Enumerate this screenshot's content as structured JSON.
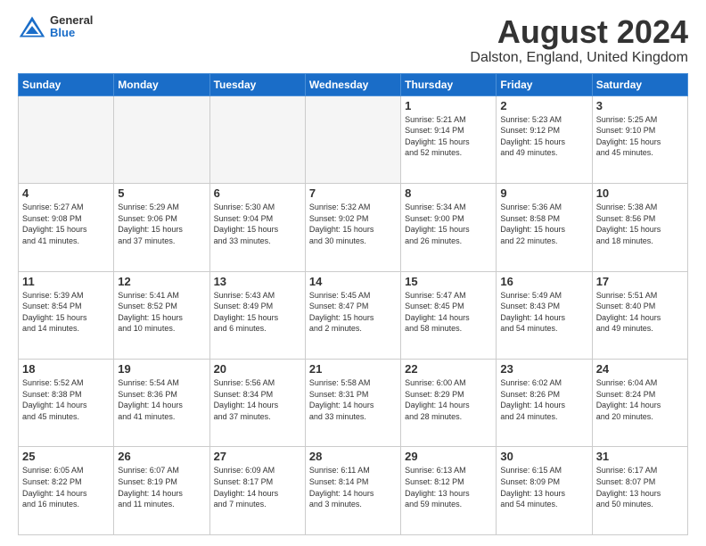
{
  "logo": {
    "general": "General",
    "blue": "Blue"
  },
  "title": "August 2024",
  "subtitle": "Dalston, England, United Kingdom",
  "days_of_week": [
    "Sunday",
    "Monday",
    "Tuesday",
    "Wednesday",
    "Thursday",
    "Friday",
    "Saturday"
  ],
  "weeks": [
    [
      {
        "day": "",
        "info": ""
      },
      {
        "day": "",
        "info": ""
      },
      {
        "day": "",
        "info": ""
      },
      {
        "day": "",
        "info": ""
      },
      {
        "day": "1",
        "info": "Sunrise: 5:21 AM\nSunset: 9:14 PM\nDaylight: 15 hours\nand 52 minutes."
      },
      {
        "day": "2",
        "info": "Sunrise: 5:23 AM\nSunset: 9:12 PM\nDaylight: 15 hours\nand 49 minutes."
      },
      {
        "day": "3",
        "info": "Sunrise: 5:25 AM\nSunset: 9:10 PM\nDaylight: 15 hours\nand 45 minutes."
      }
    ],
    [
      {
        "day": "4",
        "info": "Sunrise: 5:27 AM\nSunset: 9:08 PM\nDaylight: 15 hours\nand 41 minutes."
      },
      {
        "day": "5",
        "info": "Sunrise: 5:29 AM\nSunset: 9:06 PM\nDaylight: 15 hours\nand 37 minutes."
      },
      {
        "day": "6",
        "info": "Sunrise: 5:30 AM\nSunset: 9:04 PM\nDaylight: 15 hours\nand 33 minutes."
      },
      {
        "day": "7",
        "info": "Sunrise: 5:32 AM\nSunset: 9:02 PM\nDaylight: 15 hours\nand 30 minutes."
      },
      {
        "day": "8",
        "info": "Sunrise: 5:34 AM\nSunset: 9:00 PM\nDaylight: 15 hours\nand 26 minutes."
      },
      {
        "day": "9",
        "info": "Sunrise: 5:36 AM\nSunset: 8:58 PM\nDaylight: 15 hours\nand 22 minutes."
      },
      {
        "day": "10",
        "info": "Sunrise: 5:38 AM\nSunset: 8:56 PM\nDaylight: 15 hours\nand 18 minutes."
      }
    ],
    [
      {
        "day": "11",
        "info": "Sunrise: 5:39 AM\nSunset: 8:54 PM\nDaylight: 15 hours\nand 14 minutes."
      },
      {
        "day": "12",
        "info": "Sunrise: 5:41 AM\nSunset: 8:52 PM\nDaylight: 15 hours\nand 10 minutes."
      },
      {
        "day": "13",
        "info": "Sunrise: 5:43 AM\nSunset: 8:49 PM\nDaylight: 15 hours\nand 6 minutes."
      },
      {
        "day": "14",
        "info": "Sunrise: 5:45 AM\nSunset: 8:47 PM\nDaylight: 15 hours\nand 2 minutes."
      },
      {
        "day": "15",
        "info": "Sunrise: 5:47 AM\nSunset: 8:45 PM\nDaylight: 14 hours\nand 58 minutes."
      },
      {
        "day": "16",
        "info": "Sunrise: 5:49 AM\nSunset: 8:43 PM\nDaylight: 14 hours\nand 54 minutes."
      },
      {
        "day": "17",
        "info": "Sunrise: 5:51 AM\nSunset: 8:40 PM\nDaylight: 14 hours\nand 49 minutes."
      }
    ],
    [
      {
        "day": "18",
        "info": "Sunrise: 5:52 AM\nSunset: 8:38 PM\nDaylight: 14 hours\nand 45 minutes."
      },
      {
        "day": "19",
        "info": "Sunrise: 5:54 AM\nSunset: 8:36 PM\nDaylight: 14 hours\nand 41 minutes."
      },
      {
        "day": "20",
        "info": "Sunrise: 5:56 AM\nSunset: 8:34 PM\nDaylight: 14 hours\nand 37 minutes."
      },
      {
        "day": "21",
        "info": "Sunrise: 5:58 AM\nSunset: 8:31 PM\nDaylight: 14 hours\nand 33 minutes."
      },
      {
        "day": "22",
        "info": "Sunrise: 6:00 AM\nSunset: 8:29 PM\nDaylight: 14 hours\nand 28 minutes."
      },
      {
        "day": "23",
        "info": "Sunrise: 6:02 AM\nSunset: 8:26 PM\nDaylight: 14 hours\nand 24 minutes."
      },
      {
        "day": "24",
        "info": "Sunrise: 6:04 AM\nSunset: 8:24 PM\nDaylight: 14 hours\nand 20 minutes."
      }
    ],
    [
      {
        "day": "25",
        "info": "Sunrise: 6:05 AM\nSunset: 8:22 PM\nDaylight: 14 hours\nand 16 minutes."
      },
      {
        "day": "26",
        "info": "Sunrise: 6:07 AM\nSunset: 8:19 PM\nDaylight: 14 hours\nand 11 minutes."
      },
      {
        "day": "27",
        "info": "Sunrise: 6:09 AM\nSunset: 8:17 PM\nDaylight: 14 hours\nand 7 minutes."
      },
      {
        "day": "28",
        "info": "Sunrise: 6:11 AM\nSunset: 8:14 PM\nDaylight: 14 hours\nand 3 minutes."
      },
      {
        "day": "29",
        "info": "Sunrise: 6:13 AM\nSunset: 8:12 PM\nDaylight: 13 hours\nand 59 minutes."
      },
      {
        "day": "30",
        "info": "Sunrise: 6:15 AM\nSunset: 8:09 PM\nDaylight: 13 hours\nand 54 minutes."
      },
      {
        "day": "31",
        "info": "Sunrise: 6:17 AM\nSunset: 8:07 PM\nDaylight: 13 hours\nand 50 minutes."
      }
    ]
  ]
}
